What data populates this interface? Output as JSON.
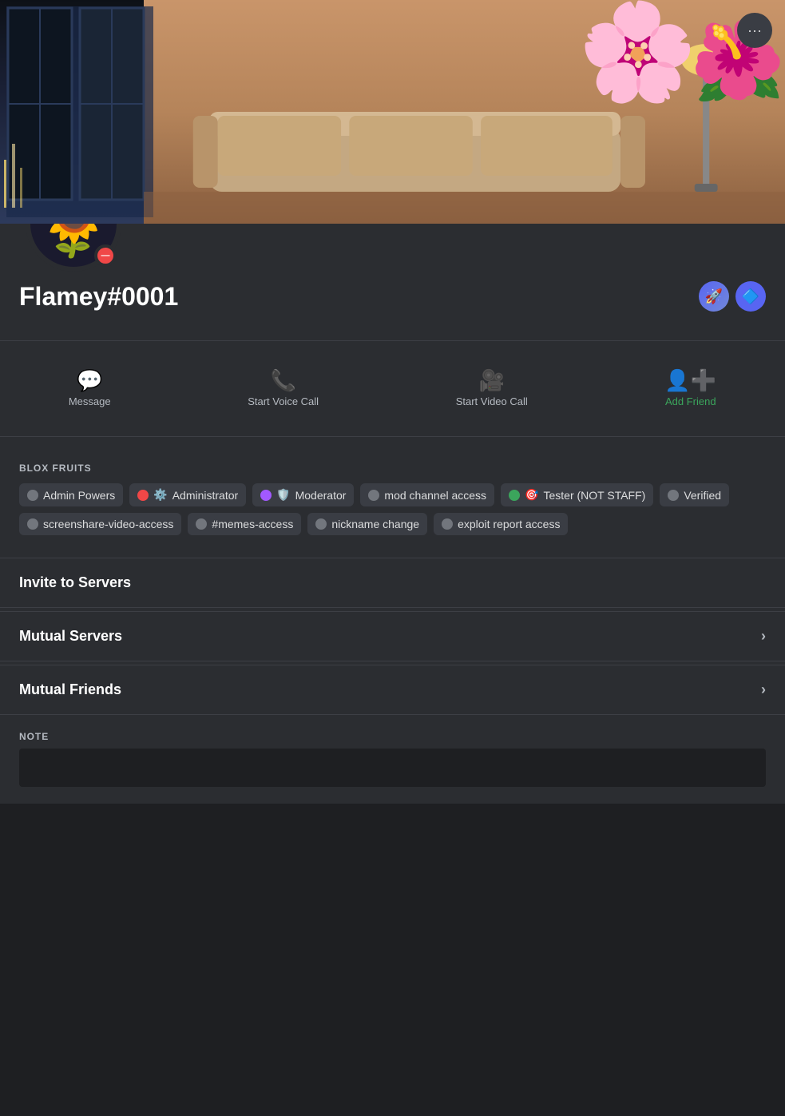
{
  "profile": {
    "username": "Flamey",
    "discriminator": "#0001",
    "avatar_emoji": "🌻",
    "status": "do-not-disturb",
    "status_color": "#f04747"
  },
  "badges": [
    {
      "name": "nitro-badge",
      "emoji": "🚀",
      "bg": "#5865f2"
    },
    {
      "name": "guild-badge",
      "emoji": "🔷",
      "bg": "#7289da"
    }
  ],
  "actions": [
    {
      "id": "message",
      "icon": "💬",
      "label": "Message",
      "green": false
    },
    {
      "id": "voice",
      "icon": "📞",
      "label": "Start Voice Call",
      "green": false
    },
    {
      "id": "video",
      "icon": "📹",
      "label": "Start Video Call",
      "green": false
    },
    {
      "id": "add-friend",
      "icon": "👤",
      "label": "Add Friend",
      "green": true
    }
  ],
  "roles_section_title": "BLOX FRUITS",
  "roles": [
    {
      "id": "admin-powers",
      "label": "Admin Powers",
      "dot_color": "#72767d",
      "emoji": null
    },
    {
      "id": "administrator",
      "label": "Administrator",
      "dot_color": "#f04747",
      "emoji": "⚙️"
    },
    {
      "id": "moderator",
      "label": "Moderator",
      "dot_color": "#a259ff",
      "emoji": "🛡️"
    },
    {
      "id": "mod-channel",
      "label": "mod channel access",
      "dot_color": "#72767d",
      "emoji": null
    },
    {
      "id": "tester",
      "label": "Tester (NOT STAFF)",
      "dot_color": "#3ba55c",
      "emoji": "🎯"
    },
    {
      "id": "verified",
      "label": "Verified",
      "dot_color": "#72767d",
      "emoji": null
    },
    {
      "id": "screenshare",
      "label": "screenshare-video-access",
      "dot_color": "#72767d",
      "emoji": null
    },
    {
      "id": "memes",
      "label": "#memes-access",
      "dot_color": "#72767d",
      "emoji": null
    },
    {
      "id": "nickname",
      "label": "nickname change",
      "dot_color": "#72767d",
      "emoji": null
    },
    {
      "id": "exploit",
      "label": "exploit report access",
      "dot_color": "#72767d",
      "emoji": null
    }
  ],
  "collapsible": [
    {
      "id": "invite-servers",
      "label": "Invite to Servers",
      "has_chevron": false
    },
    {
      "id": "mutual-servers",
      "label": "Mutual Servers",
      "has_chevron": true
    },
    {
      "id": "mutual-friends",
      "label": "Mutual Friends",
      "has_chevron": true
    }
  ],
  "note": {
    "title": "NOTE",
    "placeholder": ""
  },
  "more_button_label": "···"
}
